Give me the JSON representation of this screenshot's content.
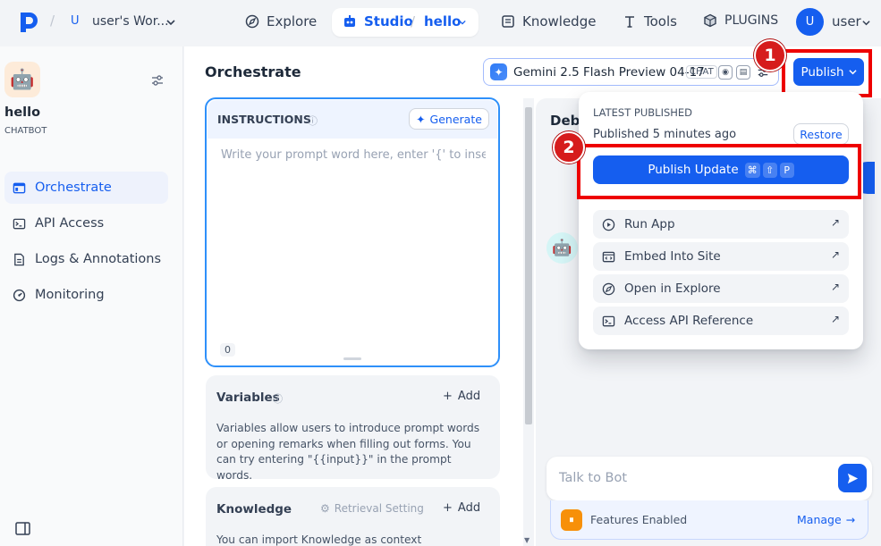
{
  "topbar": {
    "workspace_initial": "U",
    "workspace_name": "user's Wor...",
    "nav": {
      "explore": "Explore",
      "studio": "Studio",
      "app": "hello",
      "knowledge": "Knowledge",
      "tools": "Tools",
      "plugins": "PLUGINS"
    },
    "user_initial": "U",
    "user_name": "user"
  },
  "sidebar": {
    "app_name": "hello",
    "app_type": "CHATBOT",
    "items": [
      {
        "label": "Orchestrate",
        "active": true,
        "icon": "orchestrate-icon"
      },
      {
        "label": "API Access",
        "active": false,
        "icon": "terminal-icon"
      },
      {
        "label": "Logs & Annotations",
        "active": false,
        "icon": "document-icon"
      },
      {
        "label": "Monitoring",
        "active": false,
        "icon": "gauge-icon"
      }
    ]
  },
  "header": {
    "title": "Orchestrate",
    "model_name": "Gemini 2.5 Flash Preview 04-17",
    "model_mode": "CHAT",
    "publish_label": "Publish"
  },
  "instructions": {
    "title": "INSTRUCTIONS",
    "generate_label": "Generate",
    "placeholder": "Write your prompt word here, enter '{' to inser...",
    "char_count": "0"
  },
  "variables": {
    "title": "Variables",
    "add_label": "Add",
    "description": "Variables allow users to introduce prompt words or opening remarks when filling out forms. You can try entering \"{{input}}\" in the prompt words."
  },
  "knowledge": {
    "title": "Knowledge",
    "retrieval_label": "Retrieval Setting",
    "add_label": "Add",
    "description": "You can import Knowledge as context"
  },
  "debug": {
    "title": "Deb",
    "chat_placeholder": "Talk to Bot",
    "features_label": "Features Enabled",
    "manage_label": "Manage"
  },
  "publish_menu": {
    "section_label": "LATEST PUBLISHED",
    "published_time": "Published 5 minutes ago",
    "restore_label": "Restore",
    "publish_update_label": "Publish Update",
    "shortcut_keys": [
      "⌘",
      "⇧",
      "P"
    ],
    "items": [
      {
        "label": "Run App",
        "icon": "play-circle-icon"
      },
      {
        "label": "Embed Into Site",
        "icon": "embed-icon"
      },
      {
        "label": "Open in Explore",
        "icon": "compass-icon"
      },
      {
        "label": "Access API Reference",
        "icon": "terminal-icon"
      }
    ]
  },
  "annotations": {
    "badge_1": "1",
    "badge_2": "2"
  },
  "colors": {
    "accent": "#155eef",
    "highlight_red": "#e00000",
    "badge_red": "#d61c1c"
  }
}
